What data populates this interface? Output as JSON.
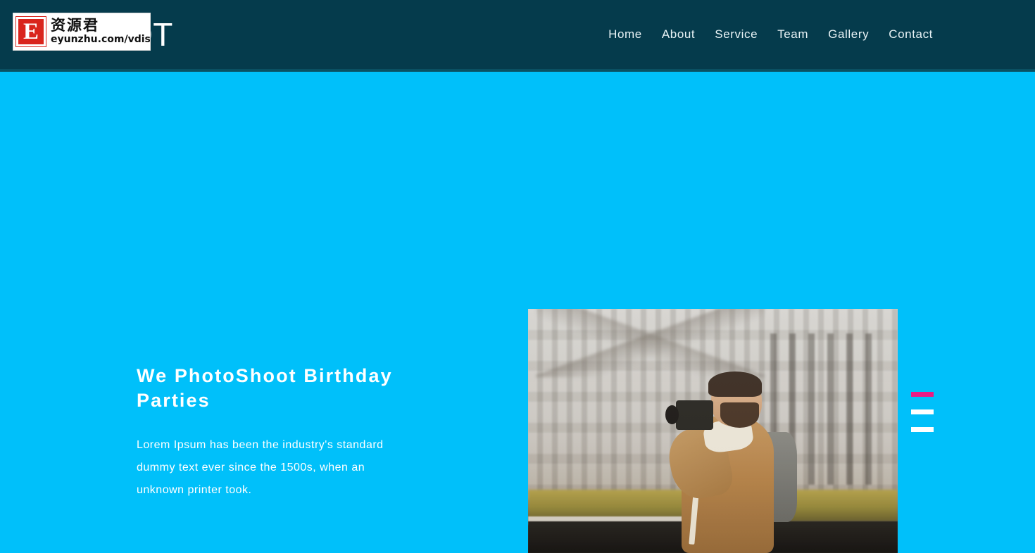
{
  "header": {
    "brand_text": "EADSHOT",
    "background_color": "#053b4c",
    "nav": [
      {
        "label": "Home"
      },
      {
        "label": "About"
      },
      {
        "label": "Service"
      },
      {
        "label": "Team"
      },
      {
        "label": "Gallery"
      },
      {
        "label": "Contact"
      }
    ]
  },
  "watermark": {
    "badge_letter": "E",
    "chinese_text": "资源君",
    "url_text": "eyunzhu.com/vdisk",
    "badge_color": "#d9251d"
  },
  "hero": {
    "background_color": "#00c0fa",
    "title": "We PhotoShoot Birthday Parties",
    "paragraph": "Lorem Ipsum has been the industry's standard dummy text ever since the 1500s, when an unknown printer took.",
    "image_alt": "Smiling photographer with camera and backpack in front of an ornate stone building",
    "slider": {
      "active_index": 0,
      "active_color": "#ec1a84",
      "inactive_color": "#ffffff",
      "items": [
        {
          "label": "slide-1"
        },
        {
          "label": "slide-2"
        },
        {
          "label": "slide-3"
        }
      ]
    }
  }
}
